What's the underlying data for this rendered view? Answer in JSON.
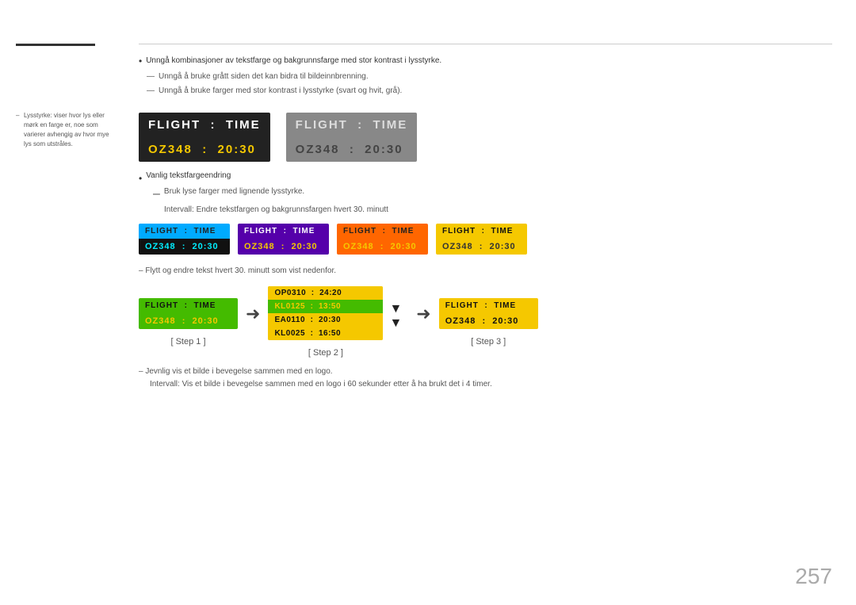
{
  "sidebar": {
    "note": "Lysstyrke: viser hvor lys eller mørk en farge er, noe som varierer avhengig av hvor mye lys som utstråles."
  },
  "bullets": {
    "main1": "Unngå kombinasjoner av tekstfarge og bakgrunnsfarge med stor kontrast i lysstyrke.",
    "main2": "Unngå å bruke grått siden det kan bidra til bildeinnbrenning.",
    "main3": "Unngå å bruke farger med stor kontrast i lysstyrke (svart og hvit, grå)."
  },
  "flight_boxes_main": {
    "label1_header": "FLIGHT   :   TIME",
    "label1_body": "OZ348    :   20:30",
    "label2_header": "FLIGHT   :   TIME",
    "label2_body": "OZ348    :   20:30"
  },
  "notes_section": {
    "title": "Vanlig tekstfargeendring",
    "dash1": "Bruk lyse farger med lignende lysstyrke.",
    "dash2": "Intervall: Endre tekstfargen og bakgrunnsfargen hvert 30. minutt"
  },
  "small_boxes": [
    {
      "variant": "cyan",
      "header": "FLIGHT   :   TIME",
      "body": "OZ348    :   20:30"
    },
    {
      "variant": "purple",
      "header": "FLIGHT   :   TIME",
      "body": "OZ348    :   20:30"
    },
    {
      "variant": "orange",
      "header": "FLIGHT   :   TIME",
      "body": "OZ348    :   20:30"
    },
    {
      "variant": "yellow",
      "header": "FLIGHT   :   TIME",
      "body": "OZ348    :   20:30"
    }
  ],
  "scroll_note": "–   Flytt og endre tekst hvert 30. minutt som vist nedenfor.",
  "steps": {
    "step1": {
      "header": "FLIGHT   :   TIME",
      "body": "OZ348    :   20:30",
      "label": "[ Step 1 ]"
    },
    "step2": {
      "rows": [
        {
          "text": "OP0310  :  24:20",
          "highlight": false
        },
        {
          "text": "KL0125  :  13:50",
          "highlight": true
        },
        {
          "text": "EA0110  :  20:30",
          "highlight": false
        },
        {
          "text": "KL0025  :  16:50",
          "highlight": false
        }
      ],
      "label": "[ Step 2 ]"
    },
    "step3": {
      "header": "FLIGHT   :   TIME",
      "body": "OZ348    :   20:30",
      "label": "[ Step 3 ]"
    }
  },
  "jevnlig_note1": "–   Jevnlig vis et bilde i bevegelse sammen med en logo.",
  "jevnlig_note2": "Intervall: Vis et bilde i bevegelse sammen med en logo i 60 sekunder etter å ha brukt det i 4 timer.",
  "page_number": "257"
}
